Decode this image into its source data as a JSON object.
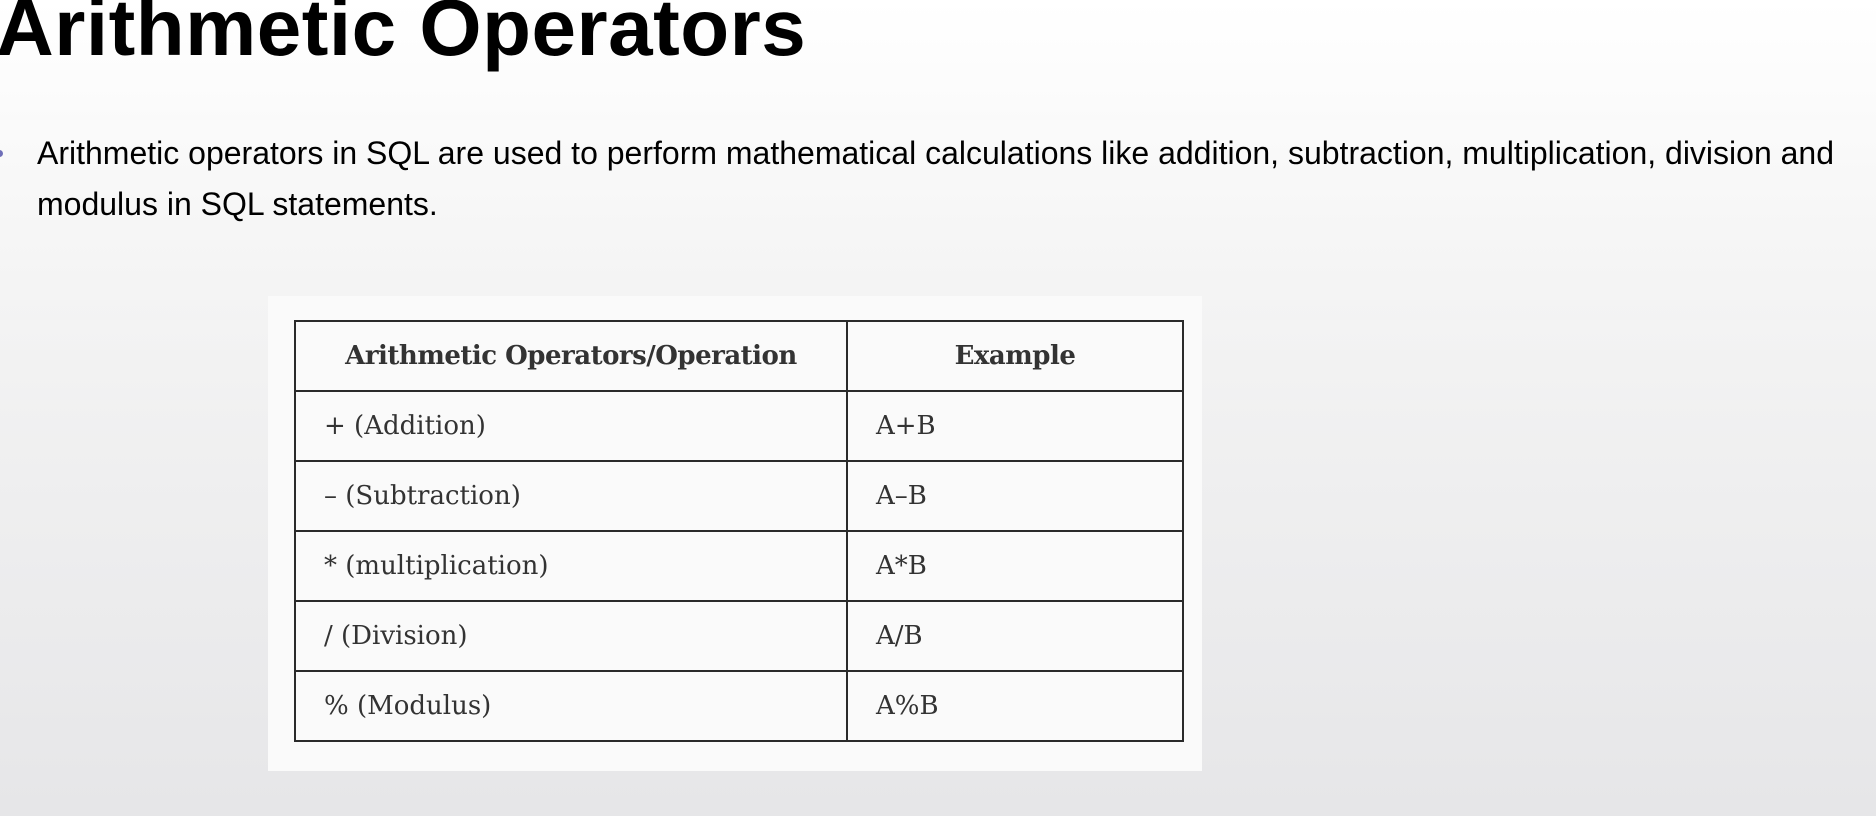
{
  "slide": {
    "title": "Arithmetic Operators",
    "bullets": [
      "Arithmetic operators in SQL are used to perform mathematical calculations like addition, subtraction, multiplication, division and modulus in SQL statements."
    ]
  },
  "table": {
    "headers": [
      "Arithmetic Operators/Operation",
      "Example"
    ],
    "rows": [
      [
        "+ (Addition)",
        "A+B"
      ],
      [
        "– (Subtraction)",
        "A–B"
      ],
      [
        "* (multiplication)",
        "A*B"
      ],
      [
        "/ (Division)",
        "A/B"
      ],
      [
        "% (Modulus)",
        "A%B"
      ]
    ]
  },
  "colors": {
    "bullet": "#6f6fb8",
    "table_border": "#2a2a2a",
    "table_text": "#333333"
  }
}
